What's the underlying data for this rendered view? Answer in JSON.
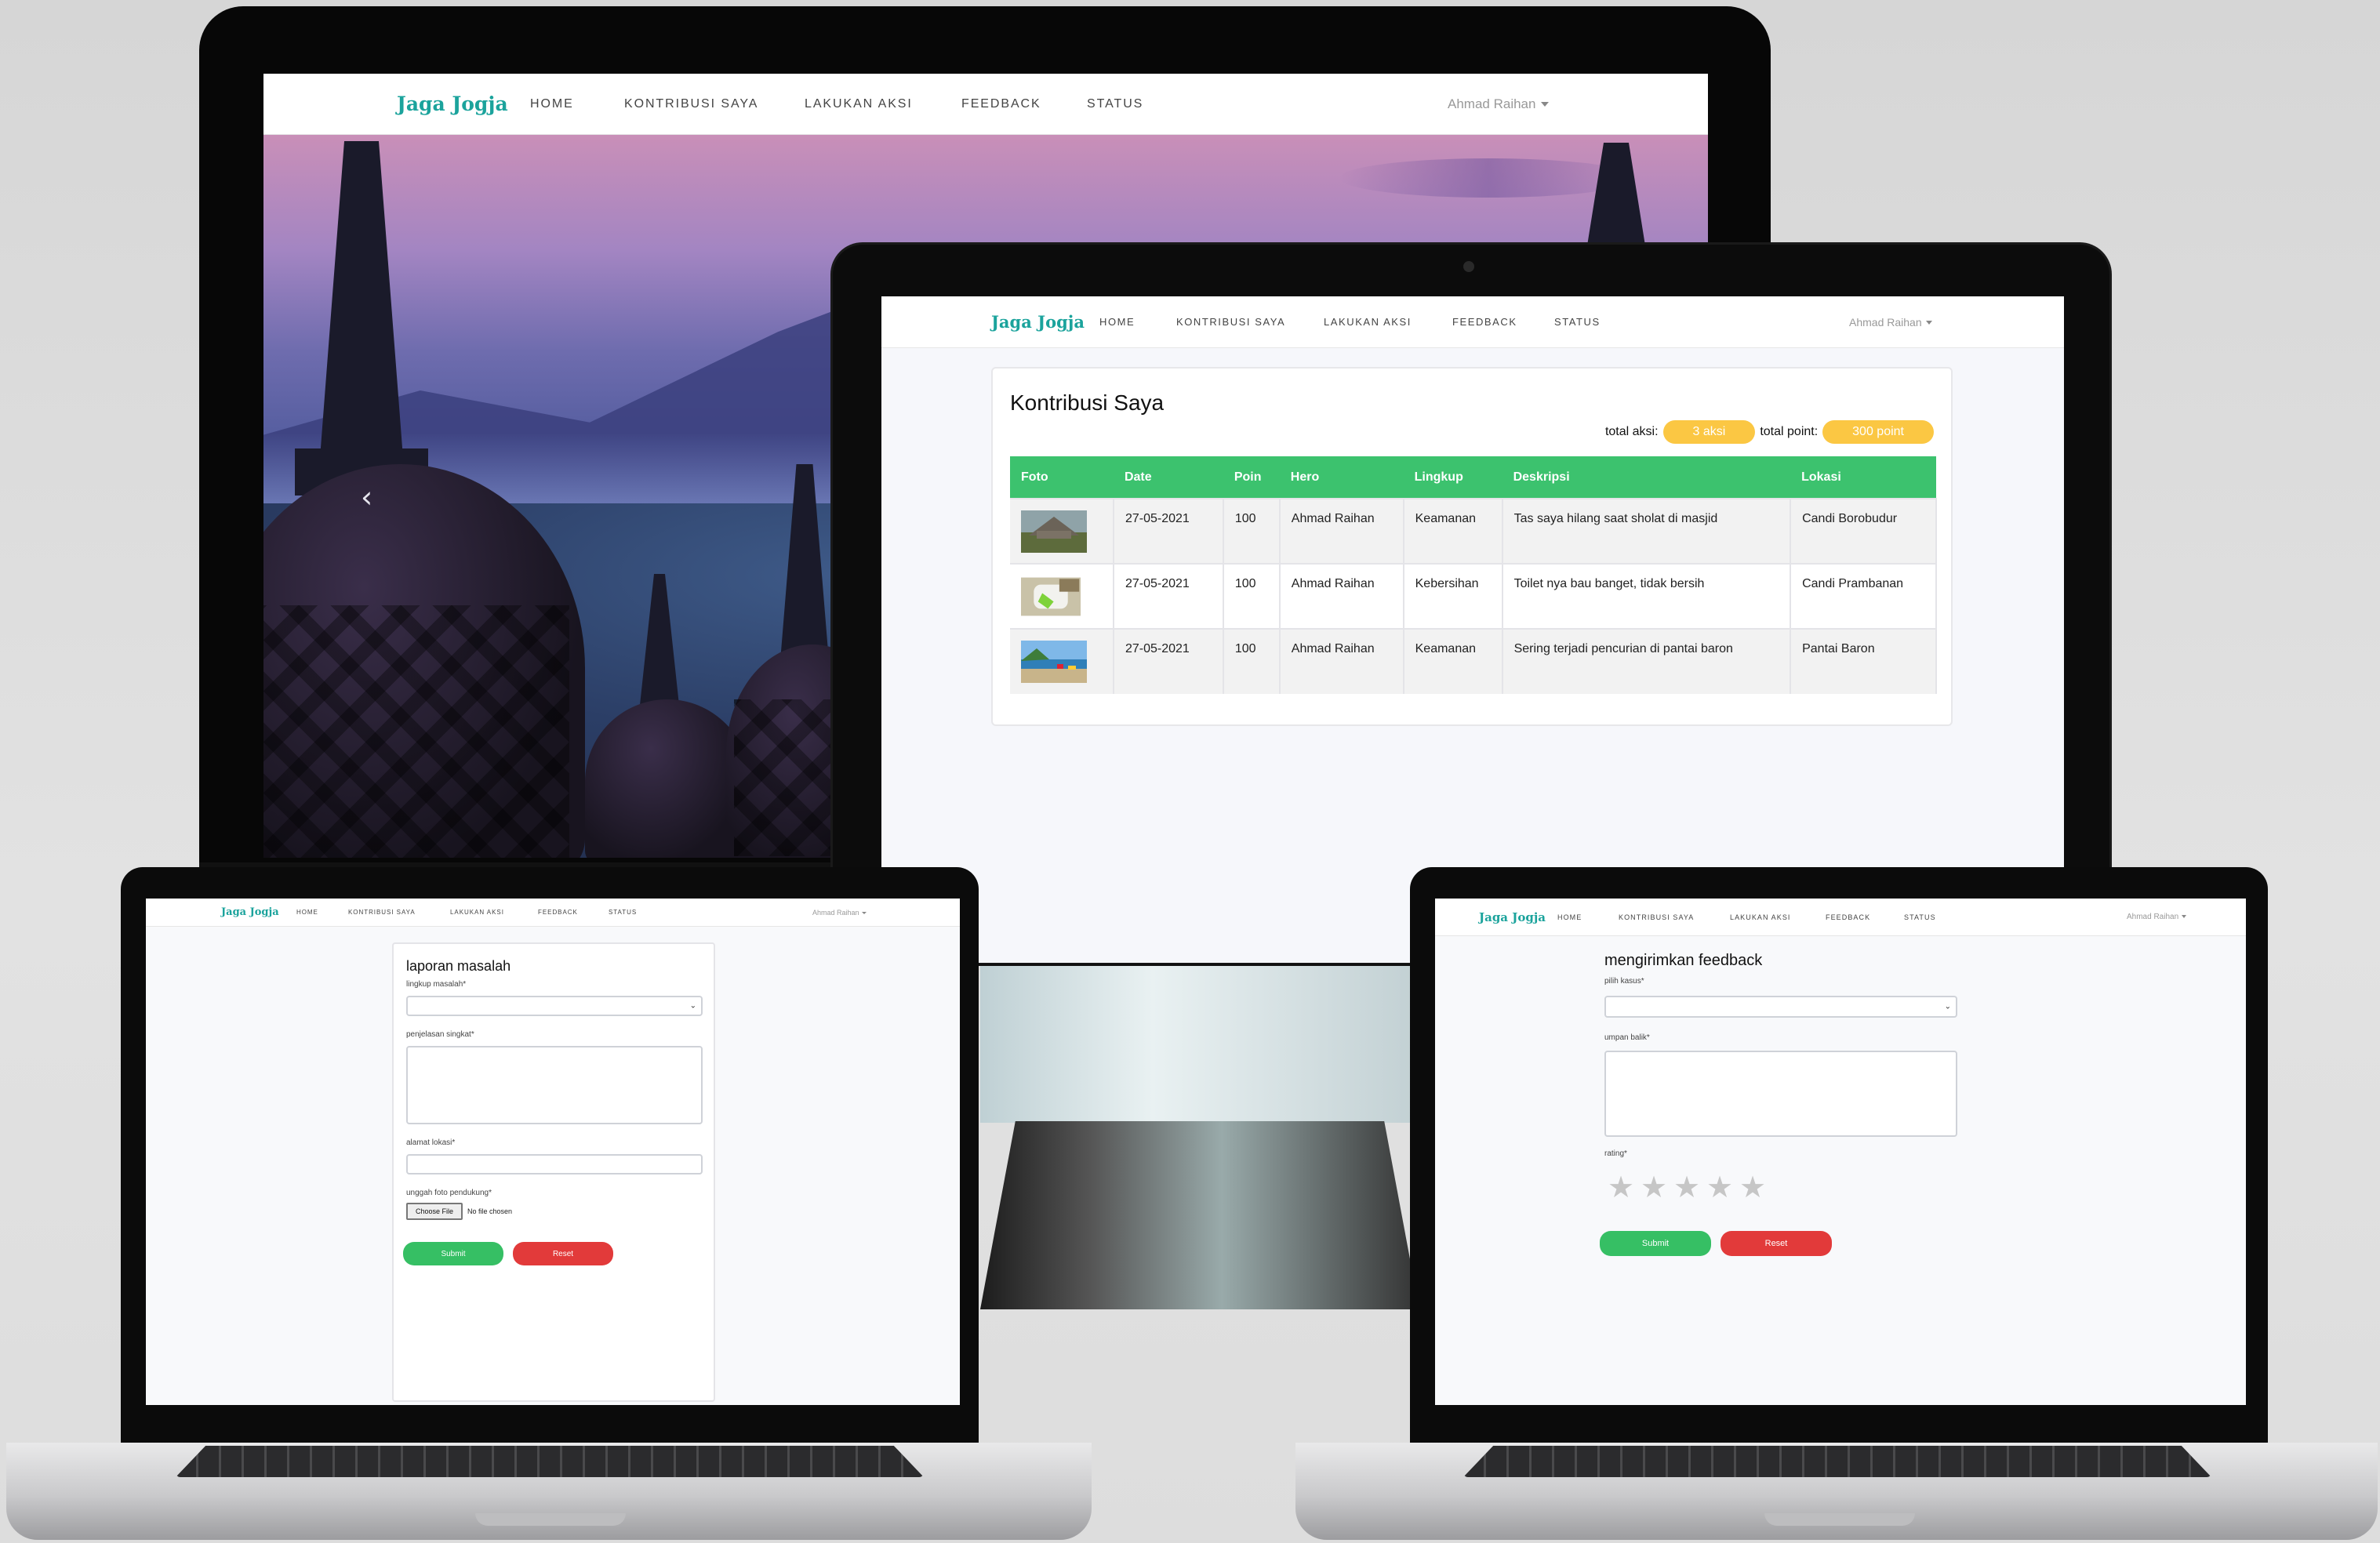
{
  "brand": "Jaga Jogja",
  "nav": {
    "items": [
      "HOME",
      "KONTRIBUSI SAYA",
      "LAKUKAN AKSI",
      "FEEDBACK",
      "STATUS"
    ],
    "user": "Ahmad Raihan"
  },
  "hero": {
    "prev_icon": "‹"
  },
  "kontribusi": {
    "title": "Kontribusi Saya",
    "total_aksi_label": "total aksi:",
    "total_aksi_value": "3 aksi",
    "total_point_label": "total point:",
    "total_point_value": "300 point",
    "columns": [
      "Foto",
      "Date",
      "Poin",
      "Hero",
      "Lingkup",
      "Deskripsi",
      "Lokasi"
    ],
    "rows": [
      {
        "date": "27-05-2021",
        "poin": "100",
        "hero": "Ahmad Raihan",
        "lingkup": "Keamanan",
        "deskripsi": "Tas saya hilang saat sholat di masjid",
        "lokasi": "Candi Borobudur"
      },
      {
        "date": "27-05-2021",
        "poin": "100",
        "hero": "Ahmad Raihan",
        "lingkup": "Kebersihan",
        "deskripsi": "Toilet nya bau banget, tidak bersih",
        "lokasi": "Candi Prambanan"
      },
      {
        "date": "27-05-2021",
        "poin": "100",
        "hero": "Ahmad Raihan",
        "lingkup": "Keamanan",
        "deskripsi": "Sering terjadi pencurian di pantai baron",
        "lokasi": "Pantai Baron"
      }
    ]
  },
  "laporan": {
    "title": "laporan masalah",
    "lingkup_label": "lingkup masalah*",
    "penjelasan_label": "penjelasan singkat*",
    "alamat_label": "alamat lokasi*",
    "foto_label": "unggah foto pendukung*",
    "choose_file": "Choose File",
    "no_file": "No file chosen",
    "submit": "Submit",
    "reset": "Reset"
  },
  "feedback": {
    "title": "mengirimkan feedback",
    "kasus_label": "pilih kasus*",
    "umpan_label": "umpan balik*",
    "rating_label": "rating*",
    "rating_stars": 5,
    "submit": "Submit",
    "reset": "Reset"
  }
}
